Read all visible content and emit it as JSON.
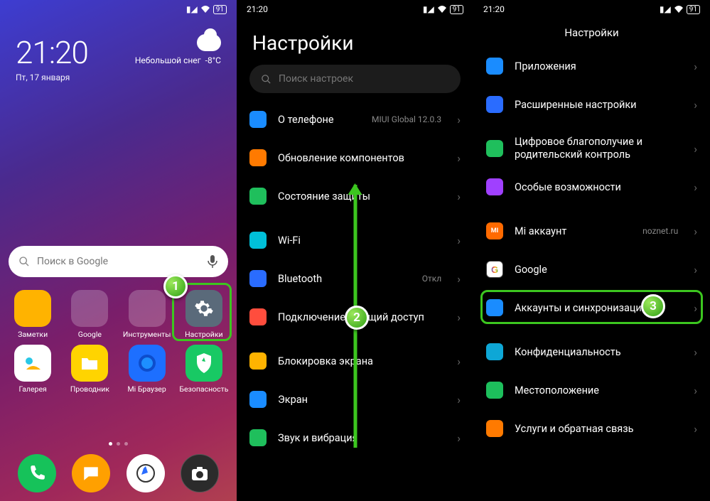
{
  "status": {
    "time": "21:20",
    "battery": "91"
  },
  "home": {
    "clock": "21:20",
    "date": "Пт, 17 января",
    "weather_text": "Небольшой снег",
    "weather_temp": "-8°C",
    "search_placeholder": "Поиск в Google",
    "apps_row1": [
      {
        "label": "Заметки",
        "color": "#ffb300"
      },
      {
        "label": "Google",
        "folder": true
      },
      {
        "label": "Инструменты",
        "folder": true
      },
      {
        "label": "Настройки",
        "color": "#6a7a8a"
      }
    ],
    "apps_row2": [
      {
        "label": "Галерея",
        "color": "#29c7e6"
      },
      {
        "label": "Проводник",
        "color": "#ffd400"
      },
      {
        "label": "Mi Браузер",
        "color": "#1d6fff"
      },
      {
        "label": "Безопасность",
        "color": "#18c964"
      }
    ],
    "dock": [
      {
        "name": "phone",
        "color": "#16c25a",
        "glyph": "phone"
      },
      {
        "name": "messages",
        "color": "#ffa000",
        "glyph": "msg"
      },
      {
        "name": "browser",
        "color": "#fff",
        "glyph": "compass"
      },
      {
        "name": "camera",
        "color": "#2b2b2b",
        "glyph": "camera"
      }
    ]
  },
  "settings": {
    "title": "Настройки",
    "search_placeholder": "Поиск настроек",
    "pane2": [
      {
        "icon": "c-blue",
        "label": "О телефоне",
        "sub": "MIUI Global 12.0.3"
      },
      {
        "icon": "c-orange",
        "label": "Обновление компонентов"
      },
      {
        "icon": "c-green",
        "label": "Состояние защиты"
      },
      {
        "sep": true
      },
      {
        "icon": "c-teal",
        "label": "Wi-Fi",
        "sub": ""
      },
      {
        "icon": "c-bt",
        "label": "Bluetooth",
        "sub": "Откл"
      },
      {
        "icon": "c-red",
        "label": "Подключение и общий доступ"
      },
      {
        "sep": true
      },
      {
        "icon": "c-yel",
        "label": "Блокировка экрана"
      },
      {
        "icon": "c-blue",
        "label": "Экран"
      },
      {
        "icon": "c-green",
        "label": "Звук и вибрация"
      }
    ],
    "pane3_header": "Настройки",
    "pane3": [
      {
        "icon": "c-blue",
        "label": "Приложения"
      },
      {
        "icon": "c-bt",
        "label": "Расширенные настройки"
      },
      {
        "sep": true
      },
      {
        "icon": "c-green",
        "label": "Цифровое благополучие и родительский контроль",
        "two": true
      },
      {
        "icon": "c-pur",
        "label": "Особые возможности"
      },
      {
        "sep": true
      },
      {
        "icon": "c-mi",
        "label": "Mi аккаунт",
        "sub": "noznet.ru"
      },
      {
        "icon": "c-goog",
        "label": "Google"
      },
      {
        "icon": "c-blue",
        "label": "Аккаунты и синхронизация"
      },
      {
        "sep": true
      },
      {
        "icon": "c-eye",
        "label": "Конфиденциальность"
      },
      {
        "icon": "c-loc",
        "label": "Местоположение"
      },
      {
        "icon": "c-fb",
        "label": "Услуги и обратная связь"
      }
    ]
  },
  "annotations": {
    "b1": "1",
    "b2": "2",
    "b3": "3"
  }
}
